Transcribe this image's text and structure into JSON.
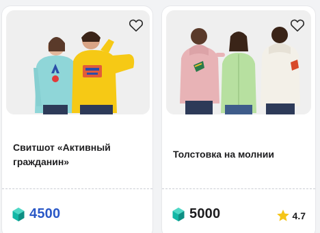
{
  "colors": {
    "price_accent": "#2a58c7",
    "gem": "#13b7a6",
    "star": "#f5c518"
  },
  "cards": [
    {
      "title": "Свитшот «Активный гражданин»",
      "price": "4500",
      "currency_icon": "gem-icon",
      "favorite_icon": "heart-outline-icon"
    },
    {
      "title": "Толстовка на молнии",
      "price": "5000",
      "rating": "4.7",
      "currency_icon": "gem-icon",
      "favorite_icon": "heart-outline-icon",
      "rating_icon": "star-icon"
    }
  ]
}
